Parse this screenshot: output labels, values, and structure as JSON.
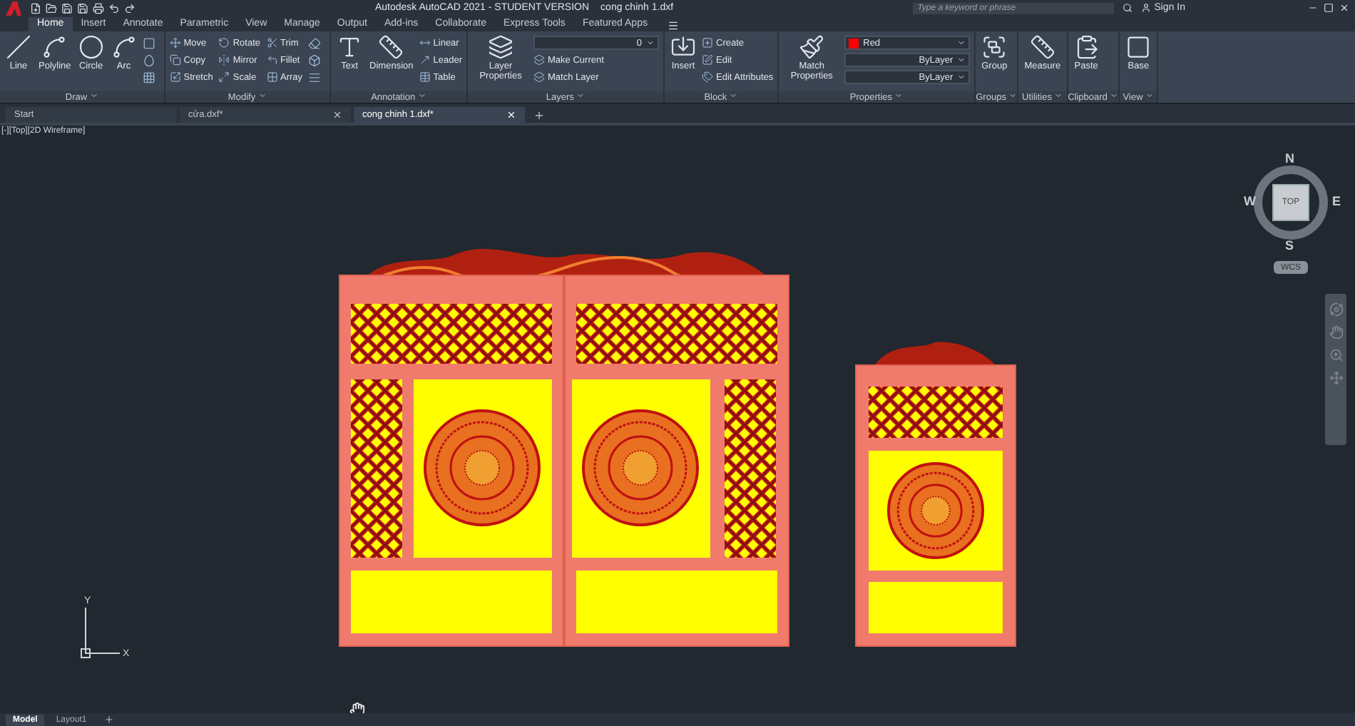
{
  "title_bar": {
    "app_title": "Autodesk AutoCAD 2021 - STUDENT VERSION",
    "file_name": "cong chinh 1.dxf",
    "search": {
      "placeholder": "Type a keyword or phrase"
    },
    "sign_in": "Sign In"
  },
  "ribbon_tabs": [
    {
      "label": "Home",
      "selected": true
    },
    {
      "label": "Insert",
      "selected": false
    },
    {
      "label": "Annotate",
      "selected": false
    },
    {
      "label": "Parametric",
      "selected": false
    },
    {
      "label": "View",
      "selected": false
    },
    {
      "label": "Manage",
      "selected": false
    },
    {
      "label": "Output",
      "selected": false
    },
    {
      "label": "Add-ins",
      "selected": false
    },
    {
      "label": "Collaborate",
      "selected": false
    },
    {
      "label": "Express Tools",
      "selected": false
    },
    {
      "label": "Featured Apps",
      "selected": false
    }
  ],
  "panels": [
    {
      "title": "Draw",
      "tools": [
        {
          "kind": "large",
          "label": "Line"
        },
        {
          "kind": "large",
          "label": "Polyline"
        },
        {
          "kind": "large",
          "label": "Circle"
        },
        {
          "kind": "large",
          "label": "Arc"
        },
        {
          "kind": "icon"
        },
        {
          "kind": "icon"
        },
        {
          "kind": "icon"
        }
      ]
    },
    {
      "title": "Modify",
      "tools": [
        {
          "kind": "small",
          "label": "Move"
        },
        {
          "kind": "small",
          "label": "Copy"
        },
        {
          "kind": "small",
          "label": "Stretch"
        },
        {
          "kind": "small",
          "label": "Rotate"
        },
        {
          "kind": "small",
          "label": "Mirror"
        },
        {
          "kind": "small",
          "label": "Scale"
        },
        {
          "kind": "small",
          "label": "Trim"
        },
        {
          "kind": "small",
          "label": "Fillet"
        },
        {
          "kind": "small",
          "label": "Array"
        },
        {
          "kind": "icon"
        },
        {
          "kind": "icon"
        },
        {
          "kind": "icon"
        }
      ]
    },
    {
      "title": "Annotation",
      "tools": [
        {
          "kind": "large",
          "label": "Text"
        },
        {
          "kind": "large",
          "label": "Dimension"
        },
        {
          "kind": "small",
          "label": "Linear"
        },
        {
          "kind": "small",
          "label": "Leader"
        },
        {
          "kind": "small",
          "label": "Table"
        }
      ]
    },
    {
      "title": "Layers",
      "tools": [
        {
          "kind": "large",
          "label": "Layer Properties"
        },
        {
          "kind": "dropdown",
          "value": "0"
        },
        {
          "kind": "small",
          "label": "Make Current"
        },
        {
          "kind": "small",
          "label": "Match Layer"
        }
      ]
    },
    {
      "title": "Block",
      "tools": [
        {
          "kind": "large",
          "label": "Insert"
        },
        {
          "kind": "small",
          "label": "Create"
        },
        {
          "kind": "small",
          "label": "Edit"
        },
        {
          "kind": "small",
          "label": "Edit Attributes"
        }
      ]
    },
    {
      "title": "Properties",
      "tools": [
        {
          "kind": "large",
          "label": "Match Properties"
        },
        {
          "kind": "dropdown",
          "value": "Red",
          "color": "#ff0000"
        },
        {
          "kind": "dropdown",
          "value": "ByLayer"
        },
        {
          "kind": "dropdown",
          "value": "ByLayer"
        }
      ]
    },
    {
      "title": "Groups",
      "tools": [
        {
          "kind": "large",
          "label": "Group"
        }
      ]
    },
    {
      "title": "Utilities",
      "tools": [
        {
          "kind": "large",
          "label": "Measure"
        }
      ]
    },
    {
      "title": "Clipboard",
      "tools": [
        {
          "kind": "large",
          "label": "Paste"
        }
      ]
    },
    {
      "title": "View",
      "tools": [
        {
          "kind": "large",
          "label": "Base"
        }
      ]
    }
  ],
  "file_tabs": [
    {
      "label": "Start",
      "selected": false,
      "closable": false
    },
    {
      "label": "cửa.dxf*",
      "selected": false,
      "closable": true
    },
    {
      "label": "cong chinh 1.dxf*",
      "selected": true,
      "closable": true
    }
  ],
  "viewport_label": "[-][Top][2D Wireframe]",
  "viewcube": {
    "top": "TOP",
    "north": "N",
    "south": "S",
    "east": "E",
    "west": "W",
    "ucs": "WCS"
  },
  "ucs_axes": {
    "x": "X",
    "y": "Y"
  },
  "layout_tabs": [
    {
      "label": "Model",
      "selected": true
    },
    {
      "label": "Layout1",
      "selected": false
    }
  ]
}
